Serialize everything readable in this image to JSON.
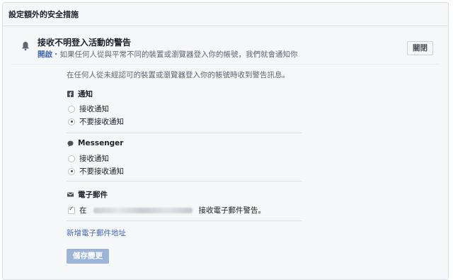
{
  "panel": {
    "title": "設定額外的安全措施"
  },
  "setting": {
    "title": "接收不明登入活動的警告",
    "status": "開啟",
    "description": "・如果任何人從與平常不同的裝置或瀏覽器登入你的帳號，我們就會通知你",
    "close_label": "關閉"
  },
  "intro_text": "在任何人從未經認可的裝置或瀏覽器登入你的帳號時收到警告訊息。",
  "sections": {
    "notifications": {
      "title": "通知",
      "options": [
        "接收通知",
        "不要接收通知"
      ],
      "selected": "不要接收通知"
    },
    "messenger": {
      "title": "Messenger",
      "options": [
        "接收通知",
        "不要接收通知"
      ],
      "selected": "不要接收通知"
    },
    "email": {
      "title": "電子郵件",
      "prefix": "在",
      "suffix": "接收電子郵件警告。",
      "checked": true
    }
  },
  "add_email_link": "新增電子郵件地址",
  "save_label": "儲存變更"
}
